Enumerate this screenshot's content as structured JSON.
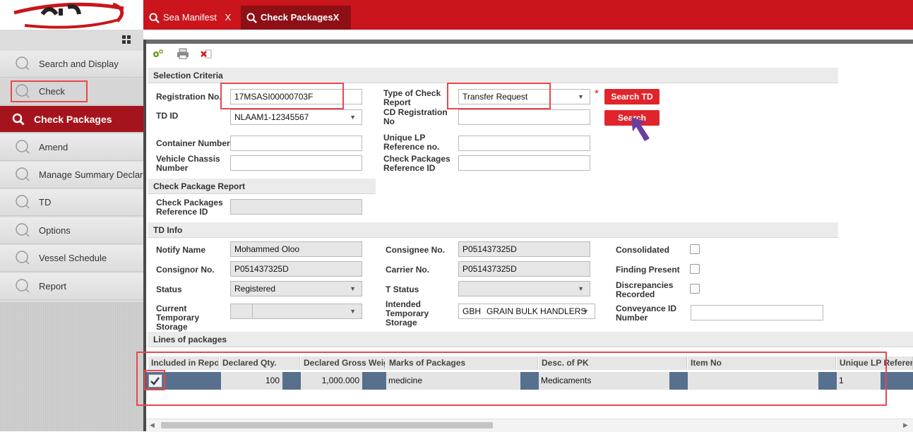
{
  "tabs": [
    {
      "label": "Sea Manifest",
      "close": "X"
    },
    {
      "label": "Check Packages",
      "close": "X"
    }
  ],
  "sidebar": {
    "items": [
      {
        "label": "Search and Display"
      },
      {
        "label": "Check"
      },
      {
        "label": "Check Packages"
      },
      {
        "label": "Amend"
      },
      {
        "label": "Manage Summary Declarat"
      },
      {
        "label": "TD"
      },
      {
        "label": "Options"
      },
      {
        "label": "Vessel Schedule"
      },
      {
        "label": "Report"
      }
    ]
  },
  "selection_criteria": {
    "title": "Selection Criteria",
    "registration_no": {
      "label": "Registration No.",
      "value": "17MSASI00000703F"
    },
    "td_id": {
      "label": "TD ID",
      "value": "NLAAM1-12345567"
    },
    "container_number": {
      "label": "Container Number",
      "value": ""
    },
    "vehicle_chassis": {
      "label": "Vehicle Chassis Number",
      "value": ""
    },
    "type_of_check": {
      "label": "Type of Check Report",
      "value": "Transfer Request",
      "required_mark": "*"
    },
    "cd_registration": {
      "label": "CD Registration No",
      "value": ""
    },
    "unique_lp": {
      "label": "Unique LP Reference no.",
      "value": ""
    },
    "check_pkg_ref": {
      "label": "Check Packages Reference ID",
      "value": ""
    },
    "search_td_button": "Search TD",
    "search_button": "Search"
  },
  "check_package_report": {
    "title": "Check Package Report",
    "ref_label": "Check Packages Reference ID",
    "ref_value": ""
  },
  "td_info": {
    "title": "TD Info",
    "notify_name": {
      "label": "Notify Name",
      "value": "Mohammed Oloo"
    },
    "consignor_no": {
      "label": "Consignor No.",
      "value": "P051437325D"
    },
    "status": {
      "label": "Status",
      "value": "Registered"
    },
    "current_temp_storage": {
      "label": "Current Temporary Storage",
      "value": ""
    },
    "consignee_no": {
      "label": "Consignee No.",
      "value": "P051437325D"
    },
    "carrier_no": {
      "label": "Carrier No.",
      "value": "P051437325D"
    },
    "t_status": {
      "label": "T Status",
      "value": ""
    },
    "intended_temp_storage": {
      "label": "Intended Temporary Storage",
      "code": "GBH",
      "value": "GRAIN BULK HANDLERS"
    },
    "consolidated": {
      "label": "Consolidated",
      "checked": false
    },
    "finding_present": {
      "label": "Finding Present",
      "checked": false
    },
    "discrepancies": {
      "label": "Discrepancies Recorded",
      "checked": false
    },
    "conveyance_id": {
      "label": "Conveyance ID Number",
      "value": ""
    }
  },
  "lines": {
    "title": "Lines of packages",
    "columns": [
      "Included in Repor",
      "Declared Qty.",
      "Declared Gross Weigh",
      "Marks of Packages",
      "Desc. of PK",
      "Item No",
      "Unique LP Referenc"
    ],
    "rows": [
      {
        "included": true,
        "declared_qty": "100",
        "gross_weight": "1,000.000",
        "marks": "medicine",
        "desc": "Medicaments",
        "item_no": "",
        "unique_lp": "1"
      }
    ]
  },
  "colors": {
    "brand_red": "#c9151b",
    "active_item": "#a5141c",
    "button_red": "#e0242b",
    "highlight": "#e8474c",
    "arrow": "#6a3ea1"
  }
}
